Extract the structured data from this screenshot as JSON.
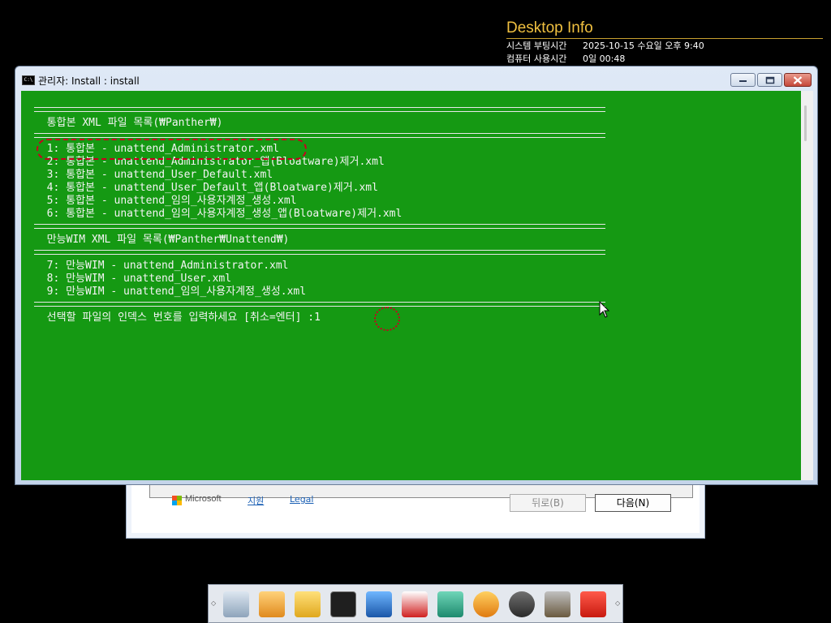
{
  "desktop_info": {
    "title": "Desktop Info",
    "rows": [
      {
        "key": "시스템 부팅시간",
        "value": "2025-10-15 수요일 오후 9:40"
      },
      {
        "key": "컴퓨터 사용시간",
        "value": "0일 00:48"
      }
    ]
  },
  "wizard": {
    "ms_label": "Microsoft",
    "support_link": "지원",
    "legal_link": "Legal",
    "back_button": "뒤로(B)",
    "next_button": "다음(N)"
  },
  "console": {
    "title": "관리자:  Install : install",
    "separator": "=====================================================================================",
    "header1": "  통합본 XML 파일 목록(₩Panther₩)",
    "items1": [
      "  1: 통합본 - unattend_Administrator.xml",
      "  2: 통합본 - unattend_Administrator_앱(Bloatware)제거.xml",
      "  3: 통합본 - unattend_User_Default.xml",
      "  4: 통합본 - unattend_User_Default_앱(Bloatware)제거.xml",
      "  5: 통합본 - unattend_임의_사용자계정_생성.xml",
      "  6: 통합본 - unattend_임의_사용자계정_생성_앱(Bloatware)제거.xml"
    ],
    "header2": "  만능WIM XML 파일 목록(₩Panther₩Unattend₩)",
    "items2": [
      "  7: 만능WIM - unattend_Administrator.xml",
      "  8: 만능WIM - unattend_User.xml",
      "  9: 만능WIM - unattend_임의_사용자계정_생성.xml"
    ],
    "prompt": "  선택할 파일의 인덱스 번호를 입력하세요 [취소=엔터] :1"
  },
  "colors": {
    "console_bg": "#159913",
    "console_text": "#f4f4f4",
    "annotation": "#c8001e",
    "desktop_info_title": "#f0c040"
  },
  "taskbar_icons": [
    "drive-icon",
    "usb-icon",
    "folder-search-icon",
    "terminal-icon",
    "monitor-icon",
    "partition-icon",
    "disk-icon",
    "refresh-icon",
    "gear-icon",
    "hammer-icon",
    "power-icon"
  ]
}
